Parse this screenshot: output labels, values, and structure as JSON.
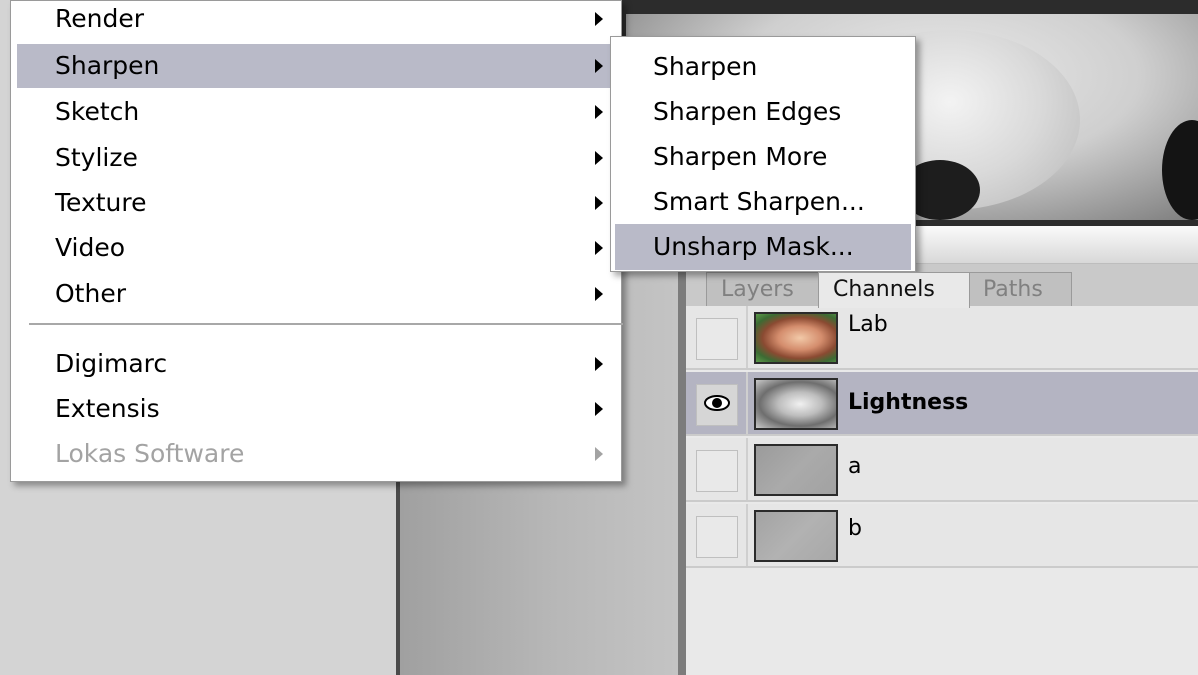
{
  "filter_menu": {
    "items": [
      {
        "label": "Render",
        "has_submenu": true
      },
      {
        "label": "Sharpen",
        "has_submenu": true,
        "highlighted": true
      },
      {
        "label": "Sketch",
        "has_submenu": true
      },
      {
        "label": "Stylize",
        "has_submenu": true
      },
      {
        "label": "Texture",
        "has_submenu": true
      },
      {
        "label": "Video",
        "has_submenu": true
      },
      {
        "label": "Other",
        "has_submenu": true
      },
      {
        "label": "Digimarc",
        "has_submenu": true
      },
      {
        "label": "Extensis",
        "has_submenu": true
      },
      {
        "label": "Lokas Software",
        "has_submenu": true,
        "disabled": true
      }
    ]
  },
  "sharpen_submenu": {
    "items": [
      {
        "label": "Sharpen"
      },
      {
        "label": "Sharpen Edges"
      },
      {
        "label": "Sharpen More"
      },
      {
        "label": "Smart Sharpen..."
      },
      {
        "label": "Unsharp Mask...",
        "highlighted": true
      }
    ]
  },
  "channels_panel": {
    "tabs": [
      {
        "label": "Layers",
        "active": false
      },
      {
        "label": "Channels",
        "active": true
      },
      {
        "label": "Paths",
        "active": false
      }
    ],
    "rows": [
      {
        "label": "Lab",
        "visible": false,
        "selected": false,
        "thumbnail": "color-face"
      },
      {
        "label": "Lightness",
        "visible": true,
        "selected": true,
        "thumbnail": "grayscale-face"
      },
      {
        "label": "a",
        "visible": false,
        "selected": false,
        "thumbnail": "flat-gray"
      },
      {
        "label": "b",
        "visible": false,
        "selected": false,
        "thumbnail": "flat-gray"
      }
    ]
  },
  "icons": {
    "eye": "eye-icon",
    "submenu_arrow": "submenu-arrow-icon"
  },
  "colors": {
    "highlight": "#b9bac8",
    "selected_row": "#b4b4c2",
    "disabled_text": "#a3a3a3"
  }
}
